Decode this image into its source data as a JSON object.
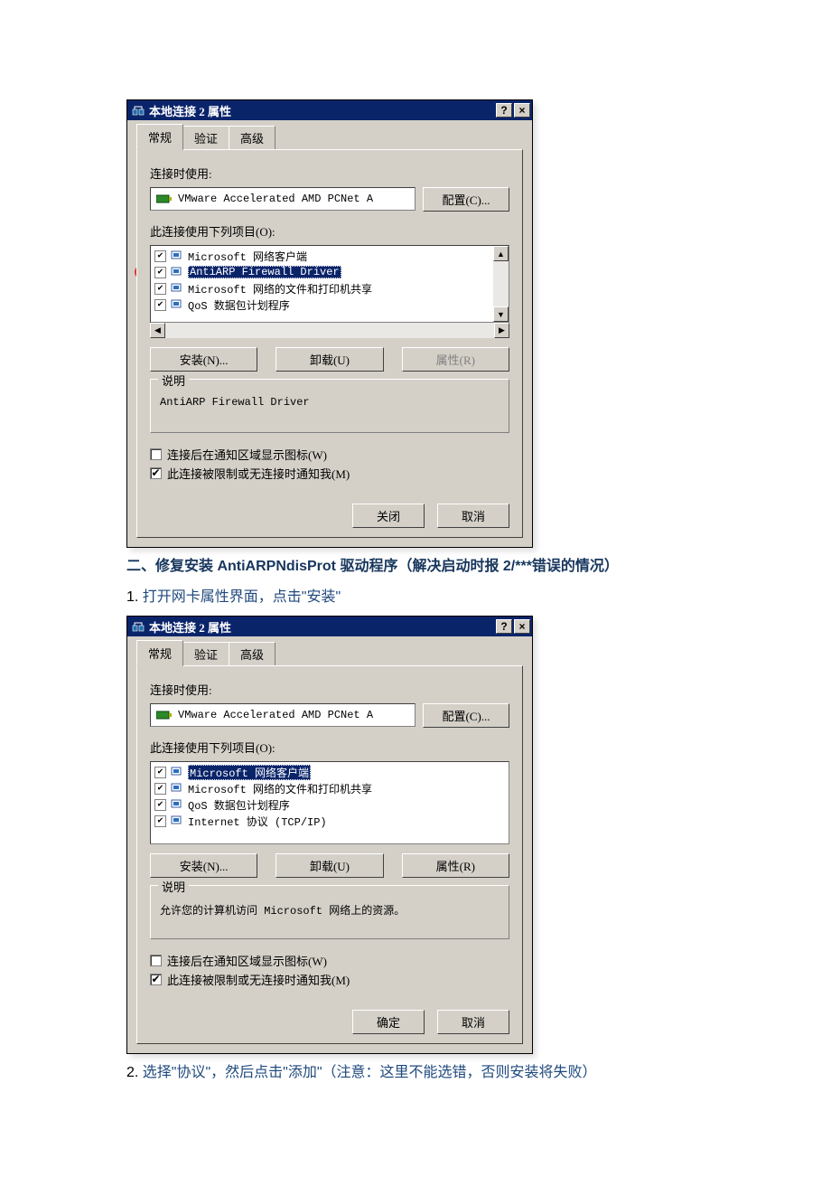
{
  "dialog1": {
    "title": "本地连接 2 属性",
    "tabs": {
      "general": "常规",
      "auth": "验证",
      "advanced": "高级"
    },
    "connect_using_label": "连接时使用:",
    "adapter": "VMware Accelerated AMD PCNet A",
    "configure_btn": "配置(C)...",
    "items_label": "此连接使用下列项目(O):",
    "items": [
      {
        "label": "Microsoft 网络客户端",
        "checked": true,
        "selected": false
      },
      {
        "label": "AntiARP Firewall Driver",
        "checked": true,
        "selected": true
      },
      {
        "label": "Microsoft 网络的文件和打印机共享",
        "checked": true,
        "selected": false
      },
      {
        "label": "QoS 数据包计划程序",
        "checked": true,
        "selected": false
      }
    ],
    "install_btn": "安装(N)...",
    "uninstall_btn": "卸载(U)",
    "properties_btn": "属性(R)",
    "desc_legend": "说明",
    "desc_text": "AntiARP Firewall Driver",
    "show_icon": "连接后在通知区域显示图标(W)",
    "show_icon_checked": false,
    "notify_me": "此连接被限制或无连接时通知我(M)",
    "notify_me_checked": true,
    "close_btn": "关闭",
    "cancel_btn": "取消"
  },
  "section2_heading": "二、修复安装 AntiARPNdisProt 驱动程序（解决启动时报 2/***错误的情况）",
  "step2_1_num": "1.",
  "step2_1_text": "打开网卡属性界面，点击\"安装\"",
  "dialog2": {
    "title": "本地连接 2 属性",
    "tabs": {
      "general": "常规",
      "auth": "验证",
      "advanced": "高级"
    },
    "connect_using_label": "连接时使用:",
    "adapter": "VMware Accelerated AMD PCNet A",
    "configure_btn": "配置(C)...",
    "items_label": "此连接使用下列项目(O):",
    "items": [
      {
        "label": "Microsoft 网络客户端",
        "checked": true,
        "selected": true
      },
      {
        "label": "Microsoft 网络的文件和打印机共享",
        "checked": true,
        "selected": false
      },
      {
        "label": "QoS 数据包计划程序",
        "checked": true,
        "selected": false
      },
      {
        "label": "Internet 协议 (TCP/IP)",
        "checked": true,
        "selected": false
      }
    ],
    "install_btn": "安装(N)...",
    "uninstall_btn": "卸载(U)",
    "properties_btn": "属性(R)",
    "desc_legend": "说明",
    "desc_text": "允许您的计算机访问 Microsoft 网络上的资源。",
    "show_icon": "连接后在通知区域显示图标(W)",
    "show_icon_checked": false,
    "notify_me": "此连接被限制或无连接时通知我(M)",
    "notify_me_checked": true,
    "ok_btn": "确定",
    "cancel_btn": "取消"
  },
  "step2_2_num": "2.",
  "step2_2_text": "选择\"协议\"，然后点击\"添加\"（注意：这里不能选错，否则安装将失败）"
}
